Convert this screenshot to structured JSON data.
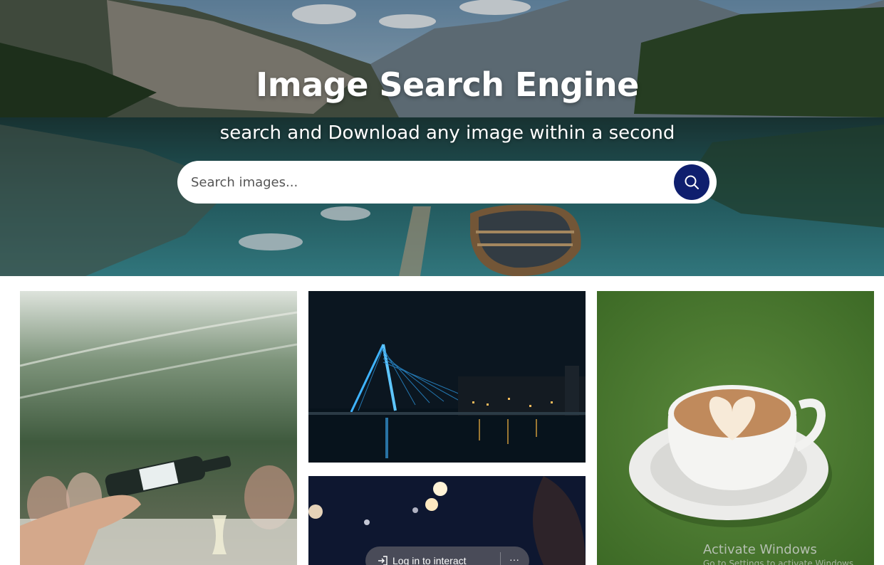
{
  "hero": {
    "title": "Image Search Engine",
    "subtitle": "search and Download any image within a second"
  },
  "search": {
    "placeholder": "Search images...",
    "value": "",
    "button_icon": "search-icon",
    "button_color": "#0f1f6e"
  },
  "gallery": {
    "images": [
      {
        "subject": "wine pouring at outdoor dinner"
      },
      {
        "subject": "cable-stayed bridge at night"
      },
      {
        "subject": "bokeh lights at night"
      },
      {
        "subject": "latte art coffee cup on green"
      }
    ],
    "overlay": {
      "login_label": "Log in to interact",
      "more_label": "···"
    }
  },
  "system": {
    "watermark_title": "Activate Windows",
    "watermark_sub": "Go to Settings to activate Windows."
  }
}
